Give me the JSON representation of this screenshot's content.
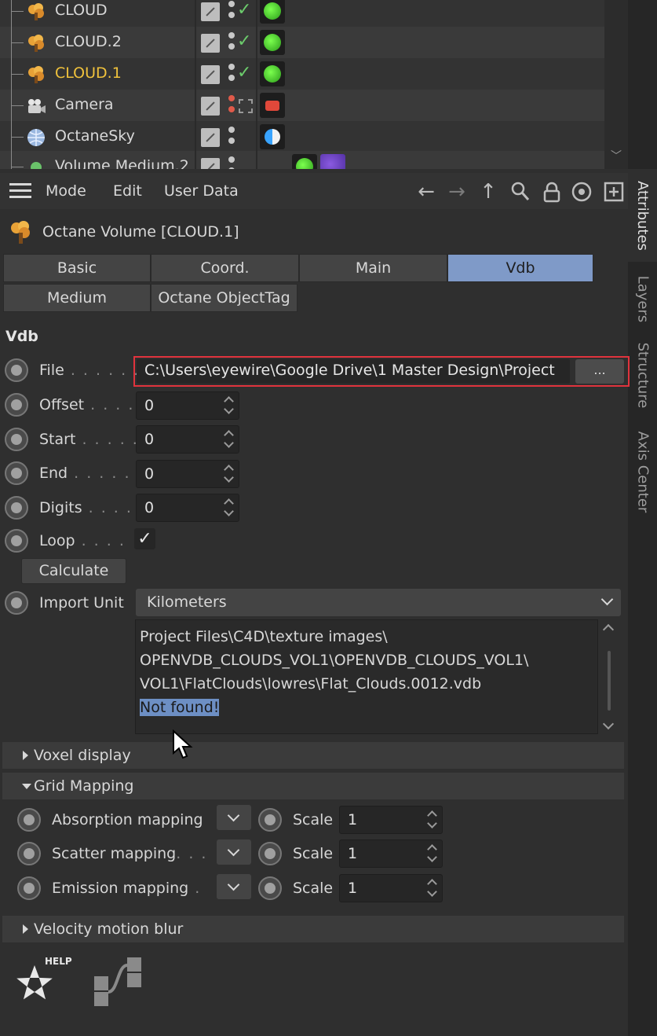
{
  "object_manager": {
    "rows": [
      {
        "name": "CLOUD",
        "selected": false,
        "icon": "cloud-volume-icon"
      },
      {
        "name": "CLOUD.2",
        "selected": false,
        "icon": "cloud-volume-icon"
      },
      {
        "name": "CLOUD.1",
        "selected": true,
        "icon": "cloud-volume-icon"
      },
      {
        "name": "Camera",
        "selected": false,
        "icon": "camera-icon"
      },
      {
        "name": "OctaneSky",
        "selected": false,
        "icon": "sky-icon"
      },
      {
        "name": "Volume Medium.2",
        "selected": false,
        "icon": "volume-icon"
      }
    ],
    "accent_selected": "#f0c23c"
  },
  "menu": {
    "mode": "Mode",
    "edit": "Edit",
    "user_data": "User Data"
  },
  "header": {
    "title": "Octane Volume [CLOUD.1]"
  },
  "tabs": {
    "row1": [
      "Basic",
      "Coord.",
      "Main",
      "Vdb"
    ],
    "row2": [
      "Medium",
      "Octane ObjectTag"
    ],
    "active": "Vdb",
    "active_color": "#7f9ac8"
  },
  "side_tabs": [
    "Attributes",
    "Layers",
    "Structure",
    "Axis Center"
  ],
  "vdb": {
    "section_title": "Vdb",
    "file_label": "File",
    "file_value": "C:\\Users\\eyewire\\Google Drive\\1 Master Design\\Project",
    "browse_label": "...",
    "offset_label": "Offset",
    "offset_value": "0",
    "start_label": "Start",
    "start_value": "0",
    "end_label": "End",
    "end_value": "0",
    "digits_label": "Digits",
    "digits_value": "0",
    "loop_label": "Loop",
    "loop_checked": true,
    "calculate_label": "Calculate",
    "import_unit_label": "Import Unit",
    "import_unit_value": "Kilometers",
    "info_lines": [
      "Project Files\\C4D\\texture images\\",
      "OPENVDB_CLOUDS_VOL1\\OPENVDB_CLOUDS_VOL1\\",
      "VOL1\\FlatClouds\\lowres\\Flat_Clouds.0012.vdb"
    ],
    "info_status": "Not found!"
  },
  "groups": {
    "voxel_display": "Voxel display",
    "grid_mapping": "Grid Mapping",
    "velocity_motion_blur": "Velocity motion blur"
  },
  "grid_mapping": {
    "rows": [
      {
        "label": "Absorption mapping",
        "scale_label": "Scale",
        "scale_value": "1"
      },
      {
        "label": "Scatter mapping",
        "scale_label": "Scale",
        "scale_value": "1"
      },
      {
        "label": "Emission mapping",
        "scale_label": "Scale",
        "scale_value": "1"
      }
    ]
  },
  "footer": {
    "help_label": "HELP"
  }
}
